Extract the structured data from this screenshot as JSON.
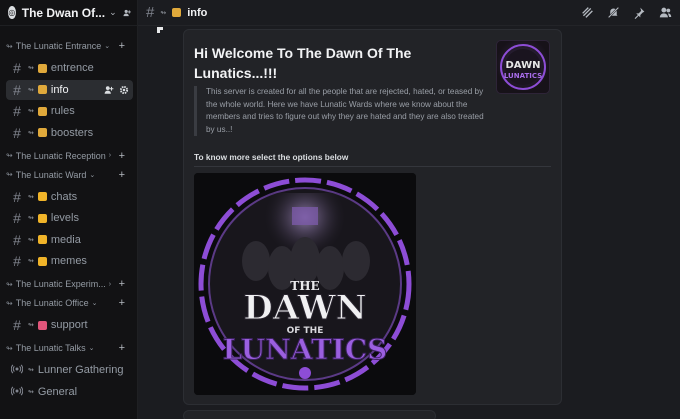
{
  "server": {
    "name": "The Dwan Of..."
  },
  "sidebar": {
    "categories": [
      {
        "name": "The Lunatic Entrance",
        "channels": [
          {
            "label": "entrence",
            "emoji_color": "#e0a93b"
          },
          {
            "label": "info",
            "emoji_color": "#e0a93b",
            "active": true
          },
          {
            "label": "rules",
            "emoji_color": "#e0a93b"
          },
          {
            "label": "boosters",
            "emoji_color": "#e0a93b"
          }
        ]
      },
      {
        "name": "The Lunatic Reception",
        "channels": []
      },
      {
        "name": "The Lunatic Ward",
        "channels": [
          {
            "label": "chats",
            "emoji_color": "#f0b429"
          },
          {
            "label": "levels",
            "emoji_color": "#f0b429"
          },
          {
            "label": "media",
            "emoji_color": "#f0b429"
          },
          {
            "label": "memes",
            "emoji_color": "#f0b429"
          }
        ]
      },
      {
        "name": "The Lunatic Experim...",
        "channels": []
      },
      {
        "name": "The Lunatic Office",
        "channels": [
          {
            "label": "support",
            "emoji_color": "#e0557a"
          }
        ]
      },
      {
        "name": "The Lunatic Talks",
        "channels": [
          {
            "label": "Lunner Gathering",
            "voice": true
          },
          {
            "label": "General",
            "voice": true
          }
        ]
      }
    ]
  },
  "topbar": {
    "channel": "info"
  },
  "embed": {
    "title": "Hi Welcome To The Dawn Of The Lunatics...!!!",
    "description": "This server is created for all the people that are rejected, hated, or teased by the whole world. Here we have Lunatic Wards where we know about the members and tries to figure out why they are hated and they are also treated by us..!",
    "field": "To know more select the options below",
    "art": {
      "line1": "THE",
      "line2": "DAWN",
      "line3": "OF THE",
      "line4": "LUNATICS",
      "thumb": "DAWN"
    }
  },
  "colors": {
    "accent_purple": "#8d4dd6",
    "active_bg": "#2b2d31"
  }
}
